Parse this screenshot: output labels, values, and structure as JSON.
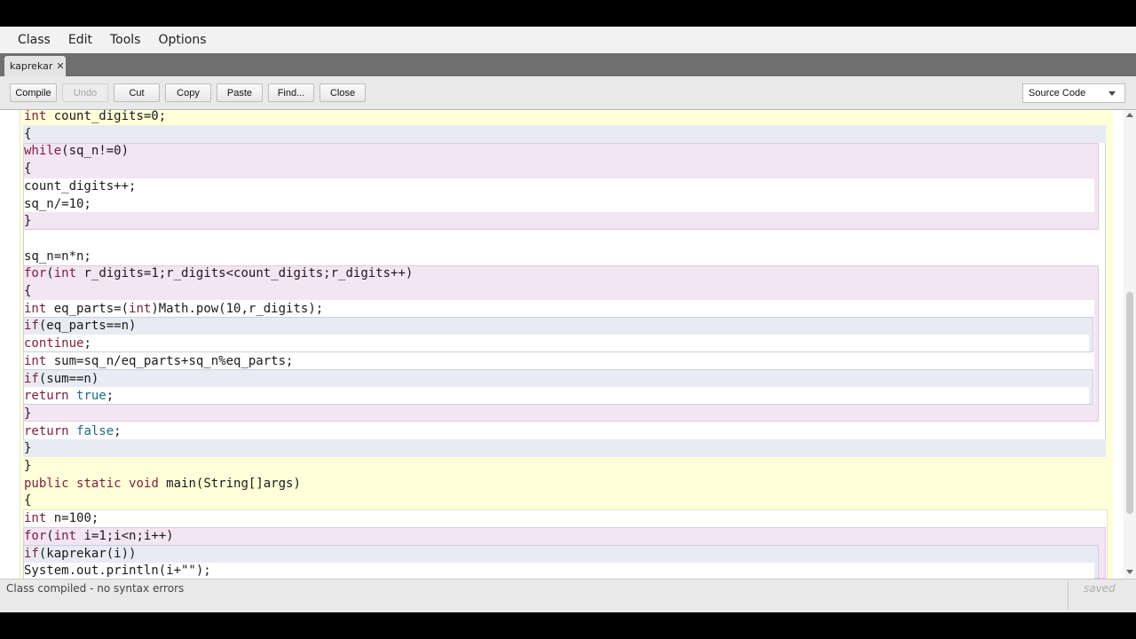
{
  "menu": [
    "Class",
    "Edit",
    "Tools",
    "Options"
  ],
  "tab": {
    "label": "kaprekar",
    "close": "✕"
  },
  "toolbar": {
    "compile": "Compile",
    "undo": "Undo",
    "cut": "Cut",
    "copy": "Copy",
    "paste": "Paste",
    "find": "Find...",
    "close": "Close",
    "view_select": "Source Code"
  },
  "code_lines": [
    "int count_digits=0;",
    "{",
    "while(sq_n!=0)",
    "{",
    "count_digits++;",
    "sq_n/=10;",
    "}",
    "",
    "sq_n=n*n;",
    "for(int r_digits=1;r_digits<count_digits;r_digits++)",
    "{",
    "int eq_parts=(int)Math.pow(10,r_digits);",
    "if(eq_parts==n)",
    "continue;",
    "int sum=sq_n/eq_parts+sq_n%eq_parts;",
    "if(sum==n)",
    "return true;",
    "}",
    "return false;",
    "}",
    "}",
    "public static void main(String[]args)",
    "{",
    "int n=100;",
    "for(int i=1;i<n;i++)",
    "if(kaprekar(i))",
    "System.out.println(i+\"\");"
  ],
  "status": {
    "message": "Class compiled - no syntax errors",
    "saved": "saved"
  },
  "colors": {
    "scope_method": "#ffffd9",
    "scope_block_blue": "#e9ebf4",
    "scope_block_pink": "#f3e5f2",
    "keyword": "#7a1f3a",
    "literal": "#1c6b84"
  }
}
